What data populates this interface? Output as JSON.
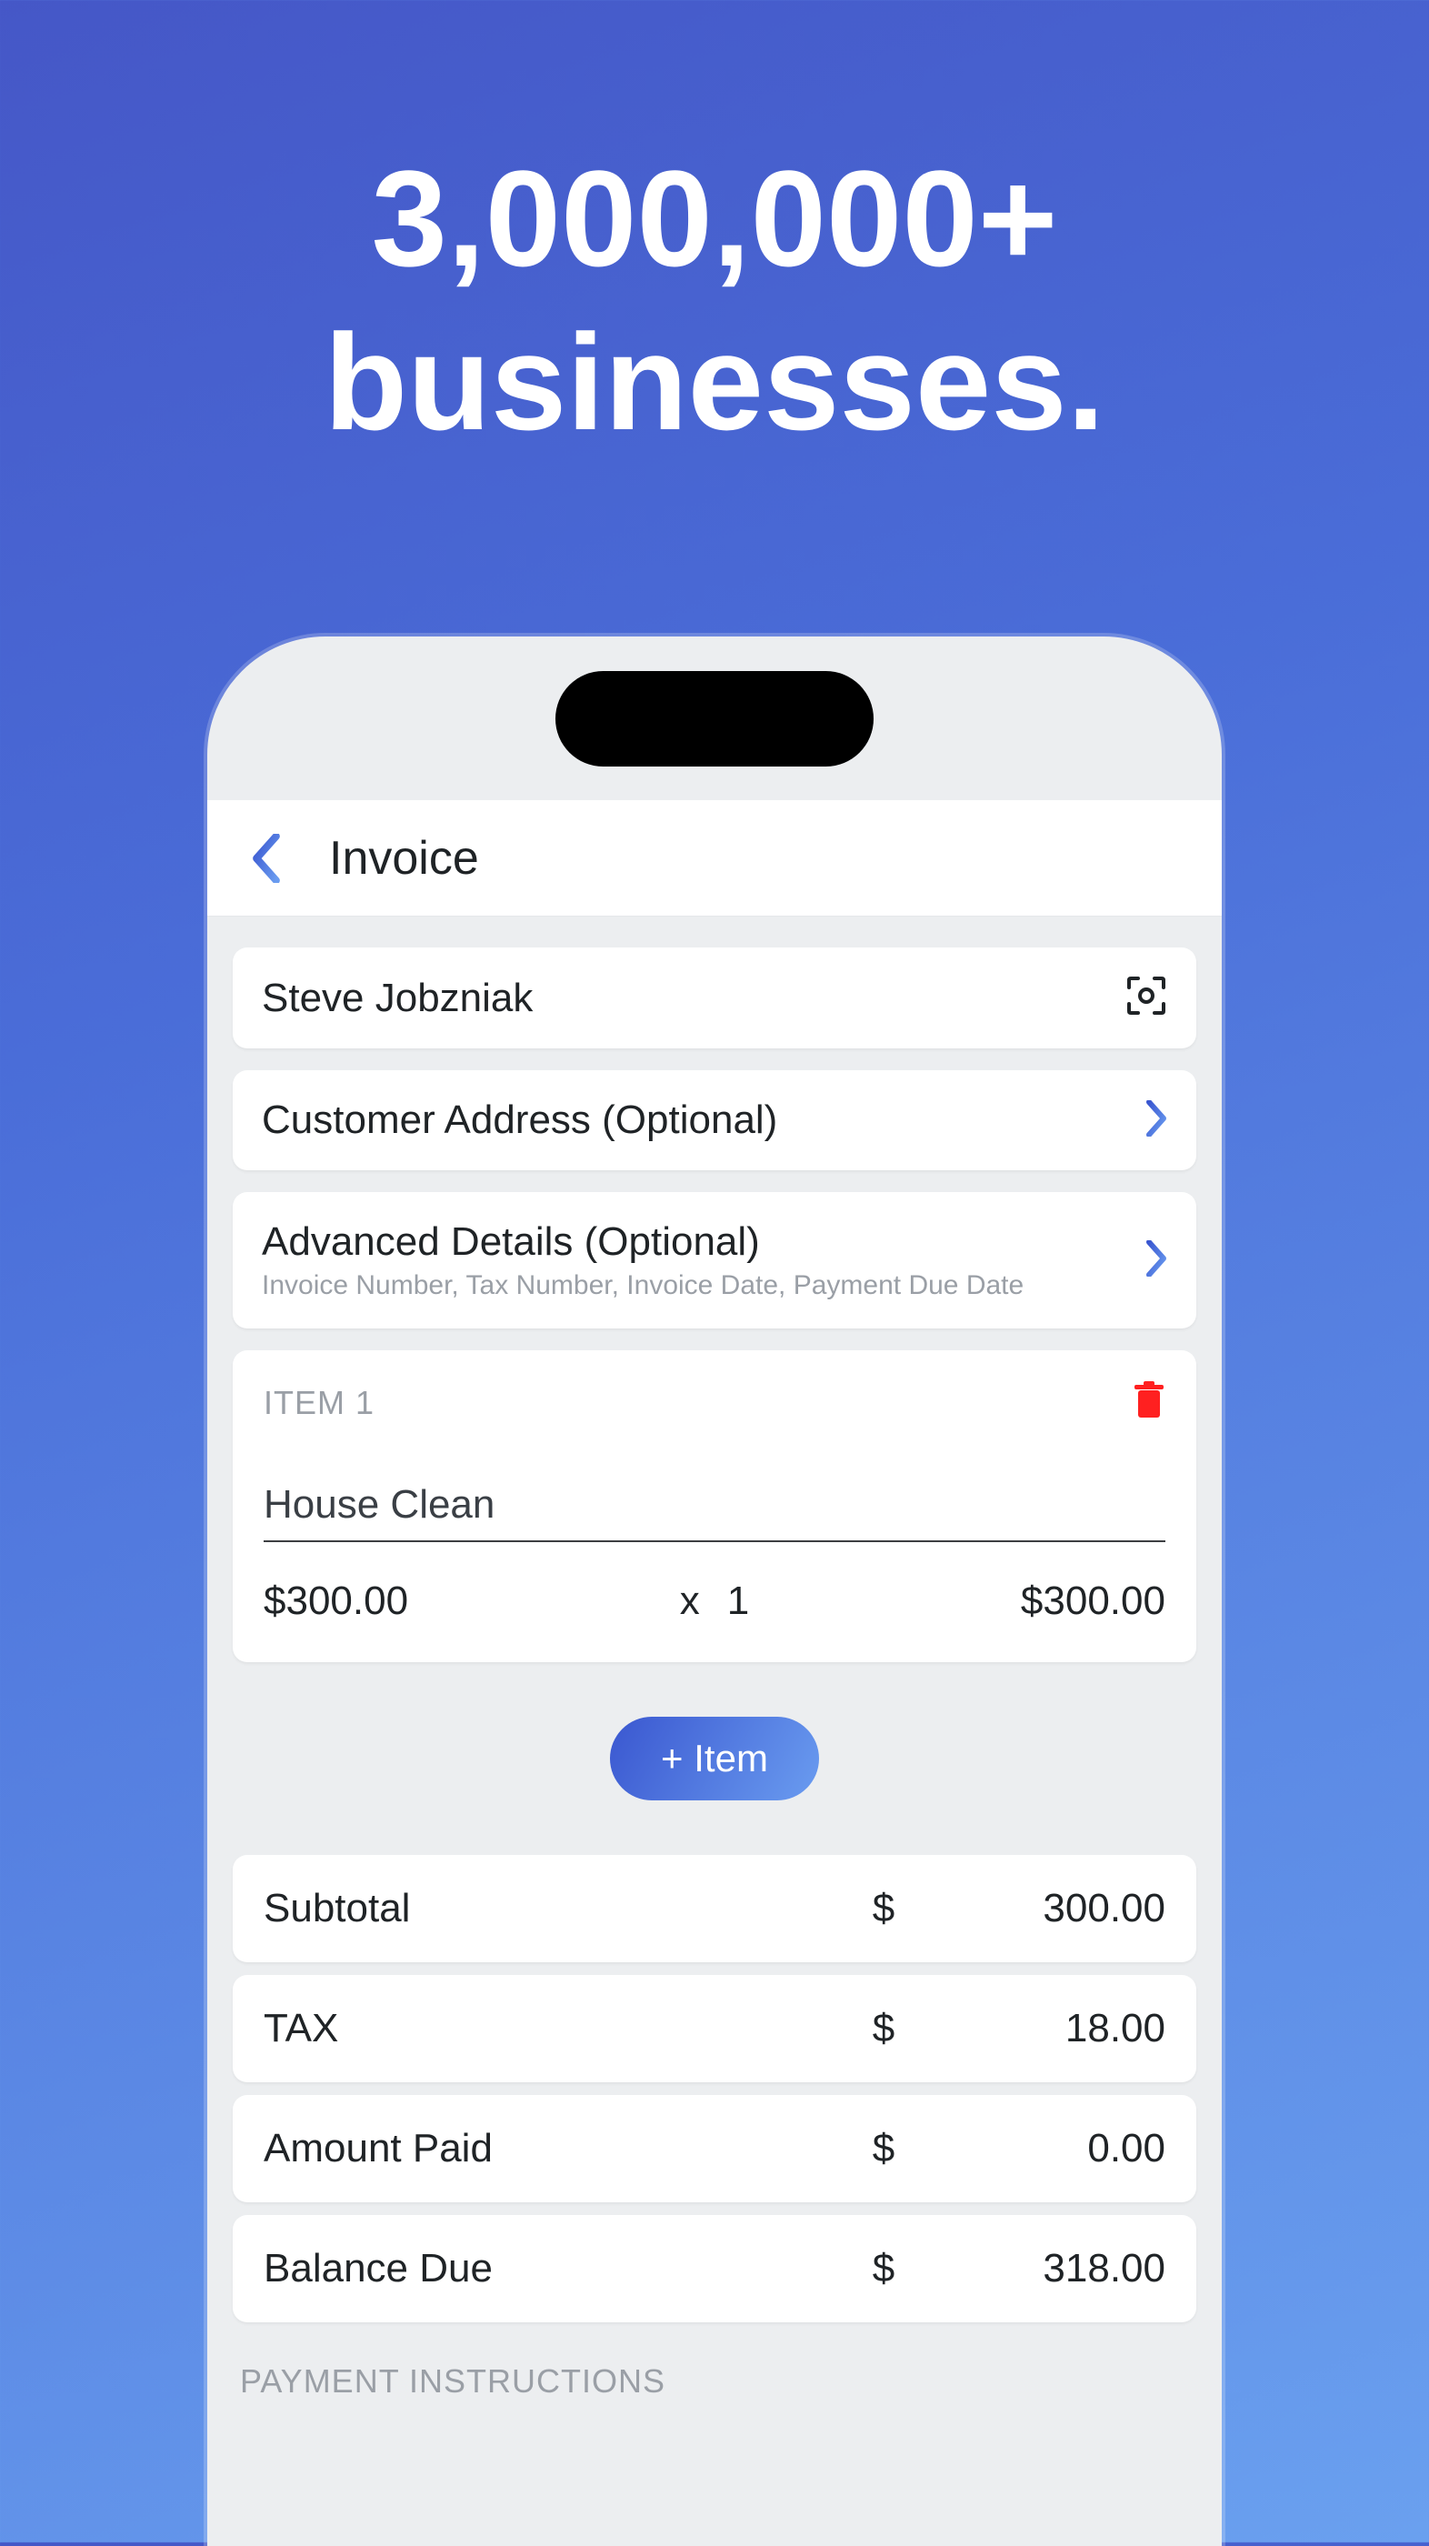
{
  "hero": {
    "line1": "3,000,000+",
    "line2": "businesses."
  },
  "nav": {
    "title": "Invoice"
  },
  "customer": {
    "name": "Steve Jobzniak"
  },
  "rows": {
    "address_label": "Customer Address (Optional)",
    "advanced_label": "Advanced Details (Optional)",
    "advanced_sub": "Invoice Number, Tax Number, Invoice Date, Payment Due Date"
  },
  "item": {
    "header": "ITEM 1",
    "name": "House Clean",
    "price": "$300.00",
    "times": "x",
    "qty": "1",
    "total": "$300.00"
  },
  "add_item_label": "+ Item",
  "summary": {
    "currency": "$",
    "subtotal_label": "Subtotal",
    "subtotal_value": "300.00",
    "tax_label": "TAX",
    "tax_value": "18.00",
    "paid_label": "Amount Paid",
    "paid_value": "0.00",
    "due_label": "Balance Due",
    "due_value": "318.00"
  },
  "section": {
    "payment_instructions": "PAYMENT INSTRUCTIONS"
  }
}
